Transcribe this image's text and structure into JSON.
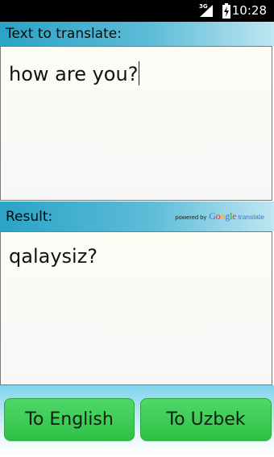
{
  "status_bar": {
    "network_label": "3G",
    "time": "10:28",
    "icons": [
      "signal-icon",
      "battery-charging-icon"
    ]
  },
  "source_section": {
    "label": "Text to translate:",
    "input_value": "how are you?"
  },
  "result_section": {
    "label": "Result:",
    "attribution": {
      "prefix": "powered by",
      "logo_letters": [
        "G",
        "o",
        "o",
        "g",
        "l",
        "e"
      ],
      "suffix": "translate"
    },
    "output_value": "qalaysiz?"
  },
  "buttons": {
    "to_english": "To English",
    "to_uzbek": "To Uzbek"
  },
  "colors": {
    "header_gradient_start": "#2aa3c6",
    "button_green": "#3ccf55",
    "status_bar": "#000000"
  }
}
